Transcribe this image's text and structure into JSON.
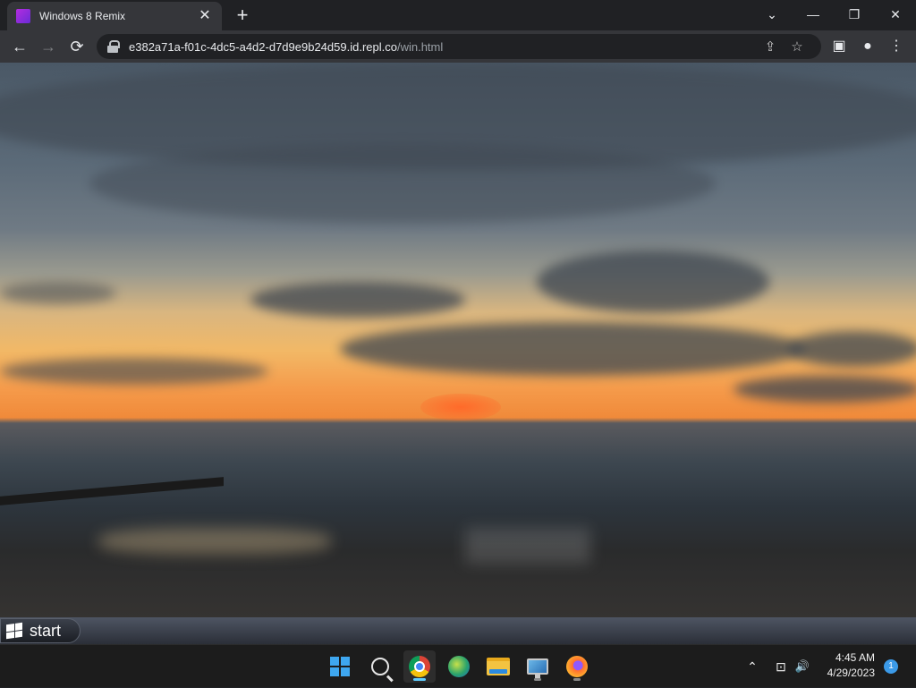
{
  "browser": {
    "tab": {
      "title": "Windows 8 Remix",
      "close": "✕"
    },
    "new_tab": "+",
    "window_controls": {
      "tab_search": "⌄",
      "minimize": "—",
      "restore": "❐",
      "close": "✕"
    },
    "nav": {
      "back": "←",
      "forward": "→",
      "reload": "⟳"
    },
    "address": {
      "host": "e382a71a-f01c-4dc5-a4d2-d7d9e9b24d59.id.repl.co",
      "path": "/win.html"
    },
    "omni_icons": {
      "share": "⇪",
      "bookmark": "☆"
    },
    "toolbar_icons": {
      "side_panel": "▣",
      "profile": "●",
      "menu": "⋮"
    }
  },
  "page": {
    "start_button": {
      "label": "start"
    }
  },
  "taskbar": {
    "tray": {
      "overflow": "⌃",
      "network": "⊡",
      "volume": "🔊"
    },
    "clock": {
      "time": "4:45 AM",
      "date": "4/29/2023"
    },
    "notifications": "1",
    "colors": {
      "accent": "#60cdff",
      "background": "#1c1c1c"
    }
  }
}
